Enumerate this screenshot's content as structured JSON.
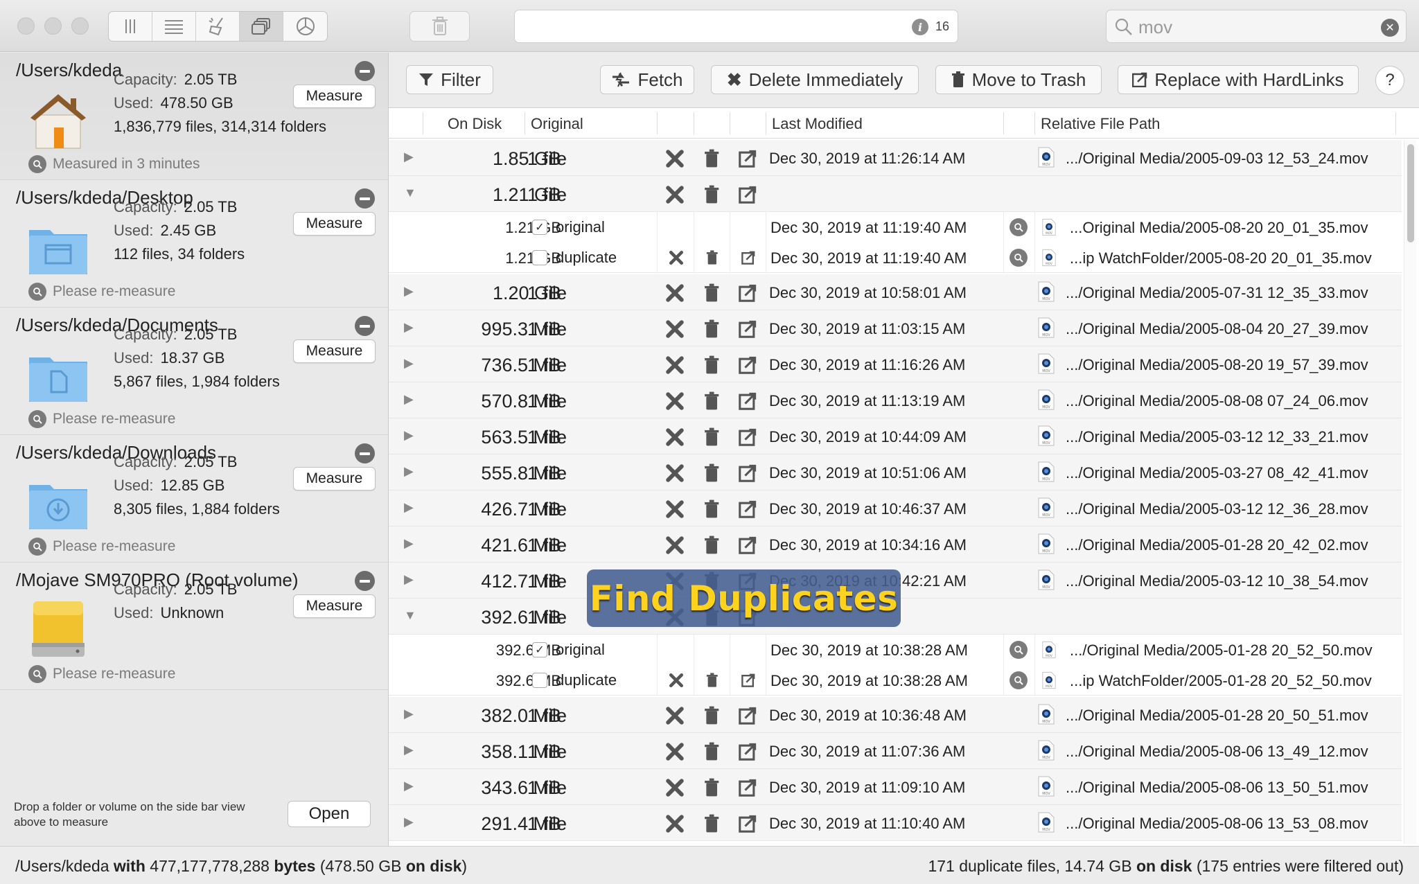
{
  "toolbar": {
    "view_icons": [
      "columns-icon",
      "list-icon",
      "sweep-icon",
      "duplicates-icon",
      "pie-icon"
    ],
    "active_view": 3,
    "status_count": "16",
    "search": {
      "value": "mov",
      "placeholder": "Search"
    }
  },
  "sidebar": {
    "measure_label": "Measure",
    "volumes": [
      {
        "path": "/Users/kdeda",
        "capacity_label": "Capacity:",
        "capacity": "2.05 TB",
        "used_label": "Used:",
        "used": "478.50 GB",
        "counts": "1,836,779 files, 314,314 folders",
        "status": "Measured in 3 minutes",
        "icon": "home-folder-icon"
      },
      {
        "path": "/Users/kdeda/Desktop",
        "capacity_label": "Capacity:",
        "capacity": "2.05 TB",
        "used_label": "Used:",
        "used": "2.45 GB",
        "counts": "112 files, 34 folders",
        "status": "Please re-measure",
        "icon": "desktop-folder-icon"
      },
      {
        "path": "/Users/kdeda/Documents",
        "capacity_label": "Capacity:",
        "capacity": "2.05 TB",
        "used_label": "Used:",
        "used": "18.37 GB",
        "counts": "5,867 files, 1,984 folders",
        "status": "Please re-measure",
        "icon": "documents-folder-icon"
      },
      {
        "path": "/Users/kdeda/Downloads",
        "capacity_label": "Capacity:",
        "capacity": "2.05 TB",
        "used_label": "Used:",
        "used": "12.85 GB",
        "counts": "8,305 files, 1,884 folders",
        "status": "Please re-measure",
        "icon": "downloads-folder-icon"
      },
      {
        "path": "/Mojave SM970PRO (Root volume)",
        "capacity_label": "Capacity:",
        "capacity": "2.05 TB",
        "used_label": "Used:",
        "used": "Unknown",
        "counts": "",
        "status": "Please re-measure",
        "icon": "drive-icon"
      }
    ],
    "drop_note": "Drop a folder or volume on the side bar view above to measure",
    "open_label": "Open"
  },
  "actions": {
    "filter": "Filter",
    "fetch": "Fetch",
    "delete_immediately": "Delete Immediately",
    "move_to_trash": "Move to Trash",
    "replace_hardlinks": "Replace with HardLinks",
    "help": "?"
  },
  "table": {
    "headers": {
      "on_disk": "On Disk",
      "original": "Original",
      "last_modified": "Last Modified",
      "path": "Relative File Path"
    },
    "rows": [
      {
        "kind": "group",
        "expanded": false,
        "size": "1.85 GB",
        "count": "1 file",
        "date": "Dec 30, 2019 at 11:26:14 AM",
        "path": ".../Original Media/2005-09-03 12_53_24.mov"
      },
      {
        "kind": "group",
        "expanded": true,
        "size": "1.21 GB",
        "count": "1 file",
        "date": "",
        "path": ""
      },
      {
        "kind": "sub",
        "size": "1.21 GB",
        "checked": true,
        "role": "original",
        "date": "Dec 30, 2019 at 11:19:40 AM",
        "path": "...Original Media/2005-08-20 20_01_35.mov"
      },
      {
        "kind": "sub",
        "size": "1.21 GB",
        "checked": false,
        "role": "duplicate",
        "date": "Dec 30, 2019 at 11:19:40 AM",
        "path": "...ip WatchFolder/2005-08-20 20_01_35.mov"
      },
      {
        "kind": "group",
        "expanded": false,
        "size": "1.20 GB",
        "count": "1 file",
        "date": "Dec 30, 2019 at 10:58:01 AM",
        "path": ".../Original Media/2005-07-31 12_35_33.mov"
      },
      {
        "kind": "group",
        "expanded": false,
        "size": "995.3 MB",
        "count": "1 file",
        "date": "Dec 30, 2019 at 11:03:15 AM",
        "path": ".../Original Media/2005-08-04 20_27_39.mov"
      },
      {
        "kind": "group",
        "expanded": false,
        "size": "736.5 MB",
        "count": "1 file",
        "date": "Dec 30, 2019 at 11:16:26 AM",
        "path": ".../Original Media/2005-08-20 19_57_39.mov"
      },
      {
        "kind": "group",
        "expanded": false,
        "size": "570.8 MB",
        "count": "1 file",
        "date": "Dec 30, 2019 at 11:13:19 AM",
        "path": ".../Original Media/2005-08-08 07_24_06.mov"
      },
      {
        "kind": "group",
        "expanded": false,
        "size": "563.5 MB",
        "count": "1 file",
        "date": "Dec 30, 2019 at 10:44:09 AM",
        "path": ".../Original Media/2005-03-12 12_33_21.mov"
      },
      {
        "kind": "group",
        "expanded": false,
        "size": "555.8 MB",
        "count": "1 file",
        "date": "Dec 30, 2019 at 10:51:06 AM",
        "path": ".../Original Media/2005-03-27 08_42_41.mov"
      },
      {
        "kind": "group",
        "expanded": false,
        "size": "426.7 MB",
        "count": "1 file",
        "date": "Dec 30, 2019 at 10:46:37 AM",
        "path": ".../Original Media/2005-03-12 12_36_28.mov"
      },
      {
        "kind": "group",
        "expanded": false,
        "size": "421.6 MB",
        "count": "1 file",
        "date": "Dec 30, 2019 at 10:34:16 AM",
        "path": ".../Original Media/2005-01-28 20_42_02.mov"
      },
      {
        "kind": "group",
        "expanded": false,
        "size": "412.7 MB",
        "count": "1 file",
        "date": "Dec 30, 2019 at 10:42:21 AM",
        "path": ".../Original Media/2005-03-12 10_38_54.mov"
      },
      {
        "kind": "group",
        "expanded": true,
        "size": "392.6 MB",
        "count": "1 file",
        "date": "",
        "path": ""
      },
      {
        "kind": "sub",
        "size": "392.6 MB",
        "checked": true,
        "role": "original",
        "date": "Dec 30, 2019 at 10:38:28 AM",
        "path": ".../Original Media/2005-01-28 20_52_50.mov"
      },
      {
        "kind": "sub",
        "size": "392.6 MB",
        "checked": false,
        "role": "duplicate",
        "date": "Dec 30, 2019 at 10:38:28 AM",
        "path": "...ip WatchFolder/2005-01-28 20_52_50.mov"
      },
      {
        "kind": "group",
        "expanded": false,
        "size": "382.0 MB",
        "count": "1 file",
        "date": "Dec 30, 2019 at 10:36:48 AM",
        "path": ".../Original Media/2005-01-28 20_50_51.mov"
      },
      {
        "kind": "group",
        "expanded": false,
        "size": "358.1 MB",
        "count": "1 file",
        "date": "Dec 30, 2019 at 11:07:36 AM",
        "path": ".../Original Media/2005-08-06 13_49_12.mov"
      },
      {
        "kind": "group",
        "expanded": false,
        "size": "343.6 MB",
        "count": "1 file",
        "date": "Dec 30, 2019 at 11:09:10 AM",
        "path": ".../Original Media/2005-08-06 13_50_51.mov"
      },
      {
        "kind": "group",
        "expanded": false,
        "size": "291.4 MB",
        "count": "1 file",
        "date": "Dec 30, 2019 at 11:10:40 AM",
        "path": ".../Original Media/2005-08-06 13_53_08.mov"
      }
    ]
  },
  "overlay_label": "Find Duplicates",
  "statusbar": {
    "left_path": "/Users/kdeda",
    "left_with": "with",
    "left_bytes": "477,177,778,288",
    "left_bytes_word": "bytes",
    "left_disk": "(478.50 GB",
    "left_disk_word": "on disk",
    "left_close": ")",
    "right_count": "171 duplicate files, 14.74 GB",
    "right_disk_word": "on disk",
    "right_filtered": "(175 entries were filtered out)"
  },
  "colors": {
    "overlay_bg": "#465f91",
    "overlay_text": "#ffd21e",
    "folder_blue": "#7cb9ea",
    "drive_yellow": "#f2c12e"
  }
}
